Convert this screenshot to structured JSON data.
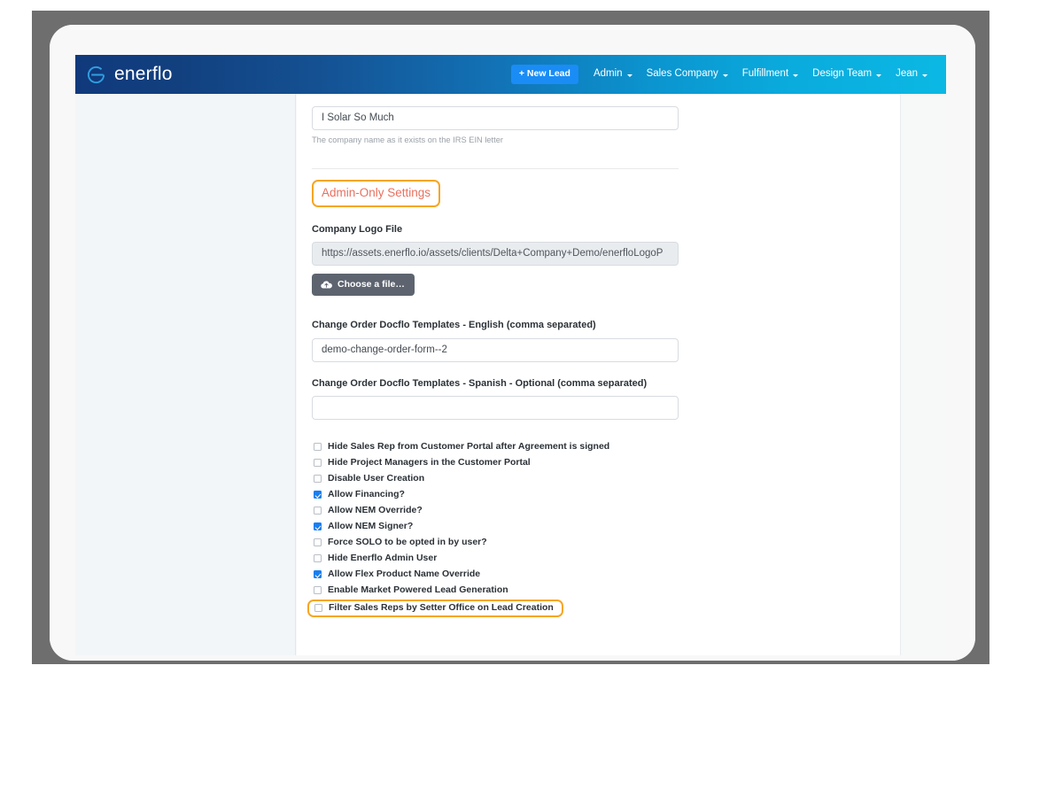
{
  "navbar": {
    "brand": "enerflo",
    "brand_icon": "enerflo-circle-logo",
    "new_lead_label": "+ New Lead",
    "items": [
      {
        "label": "Admin",
        "has_caret": true
      },
      {
        "label": "Sales Company",
        "has_caret": true
      },
      {
        "label": "Fulfillment",
        "has_caret": true
      },
      {
        "label": "Design Team",
        "has_caret": true
      },
      {
        "label": "Jean",
        "has_caret": true
      }
    ]
  },
  "form": {
    "company_name_value": "I Solar So Much",
    "company_name_help": "The company name as it exists on the IRS EIN letter",
    "section_heading": "Admin-Only Settings",
    "logo_label": "Company Logo File",
    "logo_value": "https://assets.enerflo.io/assets/clients/Delta+Company+Demo/enerfloLogoP",
    "choose_file_label": "Choose a file…",
    "choose_file_icon": "cloud-upload-icon",
    "docflo_en_label": "Change Order Docflo Templates - English (comma separated)",
    "docflo_en_value": "demo-change-order-form--2",
    "docflo_es_label": "Change Order Docflo Templates - Spanish - Optional (comma separated)",
    "docflo_es_value": "",
    "checkboxes": [
      {
        "label": "Hide Sales Rep from Customer Portal after Agreement is signed",
        "checked": false,
        "highlighted": false
      },
      {
        "label": "Hide Project Managers in the Customer Portal",
        "checked": false,
        "highlighted": false
      },
      {
        "label": "Disable User Creation",
        "checked": false,
        "highlighted": false
      },
      {
        "label": "Allow Financing?",
        "checked": true,
        "highlighted": false
      },
      {
        "label": "Allow NEM Override?",
        "checked": false,
        "highlighted": false
      },
      {
        "label": "Allow NEM Signer?",
        "checked": true,
        "highlighted": false
      },
      {
        "label": "Force SOLO to be opted in by user?",
        "checked": false,
        "highlighted": false
      },
      {
        "label": "Hide Enerflo Admin User",
        "checked": false,
        "highlighted": false
      },
      {
        "label": "Allow Flex Product Name Override",
        "checked": true,
        "highlighted": false
      },
      {
        "label": "Enable Market Powered Lead Generation",
        "checked": false,
        "highlighted": false
      },
      {
        "label": "Filter Sales Reps by Setter Office on Lead Creation",
        "checked": false,
        "highlighted": true
      }
    ]
  },
  "colors": {
    "nav_gradient_start": "#10397c",
    "nav_gradient_end": "#0bb8e4",
    "new_lead_button": "#1a8cf5",
    "highlight_outline": "#f6a623",
    "section_heading_text": "#e8705f",
    "checkbox_checked": "#1a7ef0",
    "choose_file_button": "#5d6470",
    "device_frame": "#6e6e6e"
  }
}
